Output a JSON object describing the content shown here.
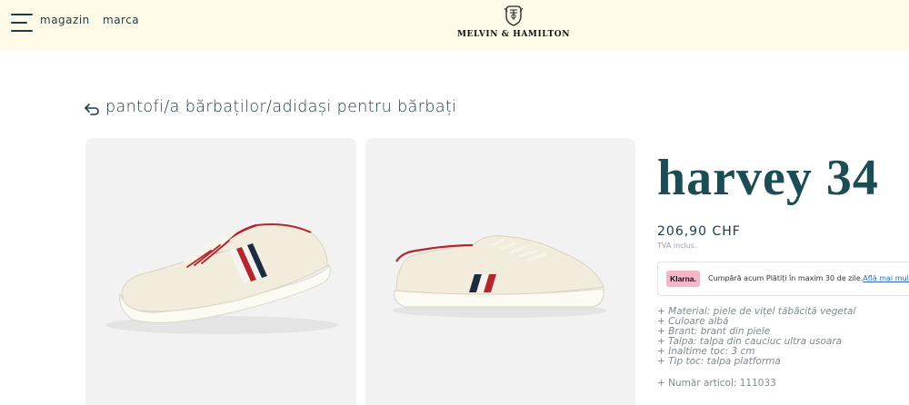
{
  "header": {
    "menu_icon": "hamburger-menu-icon",
    "nav": [
      {
        "label": "magazin"
      },
      {
        "label": "marca"
      }
    ],
    "brand": "MELVIN & HAMILTON",
    "logo_icon": "brand-crest-icon"
  },
  "breadcrumb": {
    "back_icon": "back-arrow-icon",
    "text": "pantofi/a bărbaților/adidași pentru bărbați"
  },
  "gallery": {
    "images": [
      {
        "alt": "Harvey 34 sneaker side view"
      },
      {
        "alt": "Harvey 34 sneaker side view"
      }
    ]
  },
  "product": {
    "name": "harvey 34",
    "price": "206,90 CHF",
    "vat_note": "TVA inclus.",
    "klarna": {
      "badge": "Klarna.",
      "text": "Cumpără acum Plătiți în maxim 30 de zile.",
      "link": "Află mai multe"
    },
    "specs": [
      "+ Material: piele de vițel tăbăcită vegetal",
      "+ Culoare albă",
      "+ Brant: brant din piele",
      "+ Talpa: talpa din cauciuc ultra usoara",
      "+ Inaltime toc: 3 cm",
      "+ Tip toc: talpa platforma"
    ],
    "article": "+ Număr articol: 111033"
  },
  "colors": {
    "header_bg": "#fdfbe8",
    "title": "#1c4d55",
    "klarna_pink": "#f7b6c7",
    "stripe_red": "#b3262e",
    "stripe_navy": "#1d2c40"
  }
}
